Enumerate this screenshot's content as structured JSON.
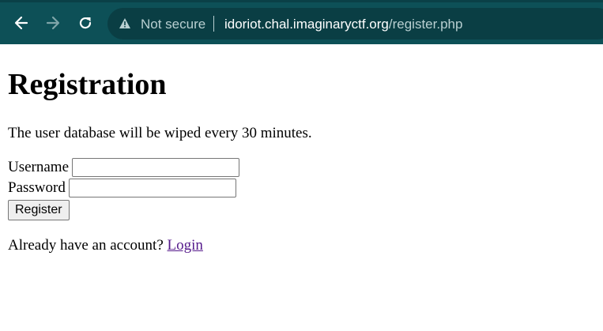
{
  "browser": {
    "back_icon": "arrow-left-icon",
    "forward_icon": "arrow-right-icon",
    "reload_icon": "reload-icon",
    "security_icon": "warning-triangle-icon",
    "security_label": "Not secure",
    "url_host": "idoriot.chal.imaginaryctf.org",
    "url_path": "/register.php",
    "colors": {
      "toolbar": "#0d5057",
      "omnibox": "#0a3e44"
    }
  },
  "page": {
    "title": "Registration",
    "notice": "The user database will be wiped every 30 minutes.",
    "form": {
      "username_label": "Username",
      "username_value": "",
      "password_label": "Password",
      "password_value": "",
      "submit_label": "Register"
    },
    "login_prompt": "Already have an account?",
    "login_link": "Login"
  }
}
